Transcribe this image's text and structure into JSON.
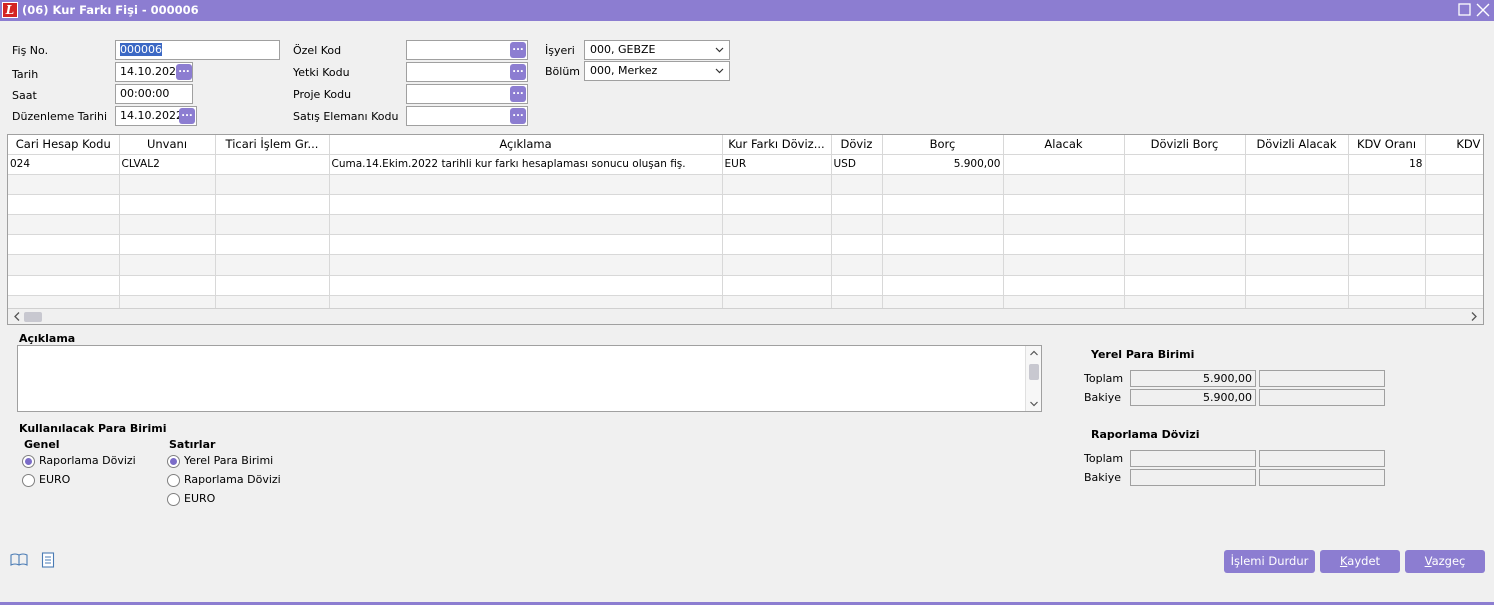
{
  "window": {
    "title": "(06) Kur Farkı Fişi - 000006",
    "logo": "L"
  },
  "header": {
    "fis_no_label": "Fiş No.",
    "fis_no_value": "000006",
    "tarih_label": "Tarih",
    "tarih_value": "14.10.2022",
    "saat_label": "Saat",
    "saat_value": "00:00:00",
    "duzenleme_label": "Düzenleme Tarihi",
    "duzenleme_value": "14.10.2022",
    "ozel_kod_label": "Özel Kod",
    "ozel_kod_value": "",
    "yetki_kodu_label": "Yetki Kodu",
    "yetki_kodu_value": "",
    "proje_kodu_label": "Proje Kodu",
    "proje_kodu_value": "",
    "satis_elemani_label": "Satış Elemanı Kodu",
    "satis_elemani_value": "",
    "isyeri_label": "İşyeri",
    "isyeri_value": "000, GEBZE",
    "bolum_label": "Bölüm",
    "bolum_value": "000, Merkez",
    "lookup_glyph": "..."
  },
  "grid": {
    "columns": [
      "Cari Hesap Kodu",
      "Unvanı",
      "Ticari İşlem Gr...",
      "Açıklama",
      "Kur Farkı Döviz...",
      "Döviz",
      "Borç",
      "Alacak",
      "Dövizli Borç",
      "Dövizli Alacak",
      "KDV Oranı",
      "KDV Tu"
    ],
    "rows": [
      [
        "024",
        "CLVAL2",
        "",
        "Cuma.14.Ekim.2022 tarihli kur farkı hesaplaması sonucu oluşan fiş.",
        "EUR",
        "USD",
        "5.900,00",
        "",
        "",
        "",
        "18",
        ""
      ]
    ],
    "empty_rows": 7
  },
  "aciklama": {
    "label": "Açıklama",
    "value": ""
  },
  "currency": {
    "title": "Kullanılacak Para Birimi",
    "genel_label": "Genel",
    "genel_options": [
      {
        "label": "Raporlama Dövizi",
        "selected": true
      },
      {
        "label": "EURO",
        "selected": false
      }
    ],
    "satirlar_label": "Satırlar",
    "satirlar_options": [
      {
        "label": "Yerel Para Birimi",
        "selected": true
      },
      {
        "label": "Raporlama Dövizi",
        "selected": false
      },
      {
        "label": "EURO",
        "selected": false
      }
    ]
  },
  "totals": {
    "yerel_title": "Yerel Para Birimi",
    "yerel_toplam_label": "Toplam",
    "yerel_toplam_1": "5.900,00",
    "yerel_toplam_2": "",
    "yerel_bakiye_label": "Bakiye",
    "yerel_bakiye_1": "5.900,00",
    "yerel_bakiye_2": "",
    "rapor_title": "Raporlama Dövizi",
    "rapor_toplam_label": "Toplam",
    "rapor_toplam_1": "",
    "rapor_toplam_2": "",
    "rapor_bakiye_label": "Bakiye",
    "rapor_bakiye_1": "",
    "rapor_bakiye_2": ""
  },
  "buttons": {
    "durdur": "İşlemi Durdur",
    "kaydet_u": "K",
    "kaydet_rest": "aydet",
    "vazgec_u": "V",
    "vazgec_rest": "azgeç"
  },
  "icons": {
    "book": "book-icon",
    "note": "document-icon"
  },
  "colors": {
    "accent": "#8c7dd1",
    "selection": "#3b68c4"
  }
}
